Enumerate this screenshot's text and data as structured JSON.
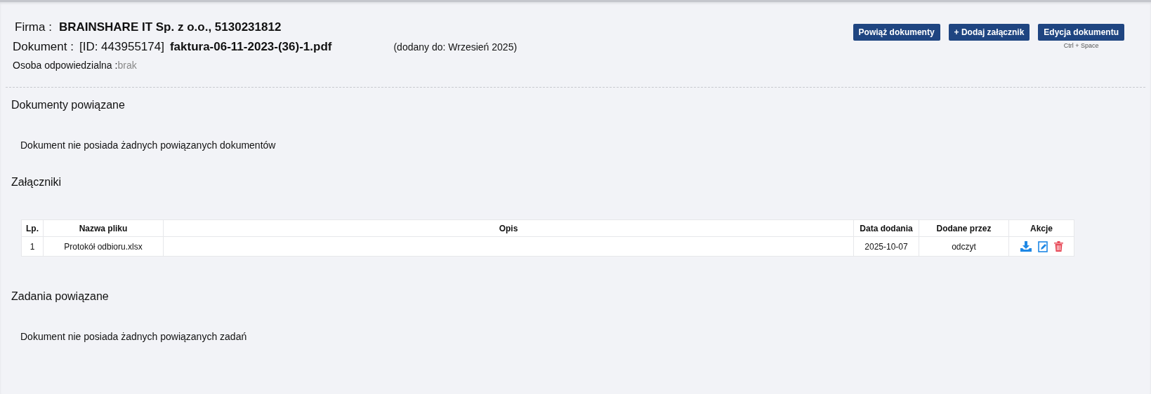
{
  "header": {
    "company_label": "Firma :",
    "company": "BRAINSHARE IT Sp. z o.o., 5130231812",
    "document_label": "Dokument :",
    "document_id": "[ID: 443955174]",
    "document_name": "faktura-06-11-2023-(36)-1.pdf",
    "added_to": "(dodany do: Wrzesień 2025)",
    "owner_label": "Osoba odpowiedzialna :",
    "owner": "brak"
  },
  "actions": [
    {
      "label": "Powiąż dokumenty"
    },
    {
      "label": "+ Dodaj załącznik"
    },
    {
      "label": "Edycja dokumentu",
      "shortcut": "Ctrl + Space"
    }
  ],
  "related_documents": {
    "title": "Dokumenty powiązane",
    "empty_message": "Dokument nie posiada żadnych powiązanych dokumentów"
  },
  "attachments": {
    "title": "Załączniki",
    "columns": [
      "Lp.",
      "Nazwa pliku",
      "Opis",
      "Data dodania",
      "Dodane przez",
      "Akcje"
    ],
    "rows": [
      {
        "number": "1",
        "file_name": "Protokół odbioru.xlsx",
        "date": "2025-10-07",
        "added_by": "odczyt"
      }
    ]
  },
  "related_tasks": {
    "title": "Zadania powiązane",
    "empty_message": "Dokument nie posiada żadnych powiązanych zadań"
  }
}
